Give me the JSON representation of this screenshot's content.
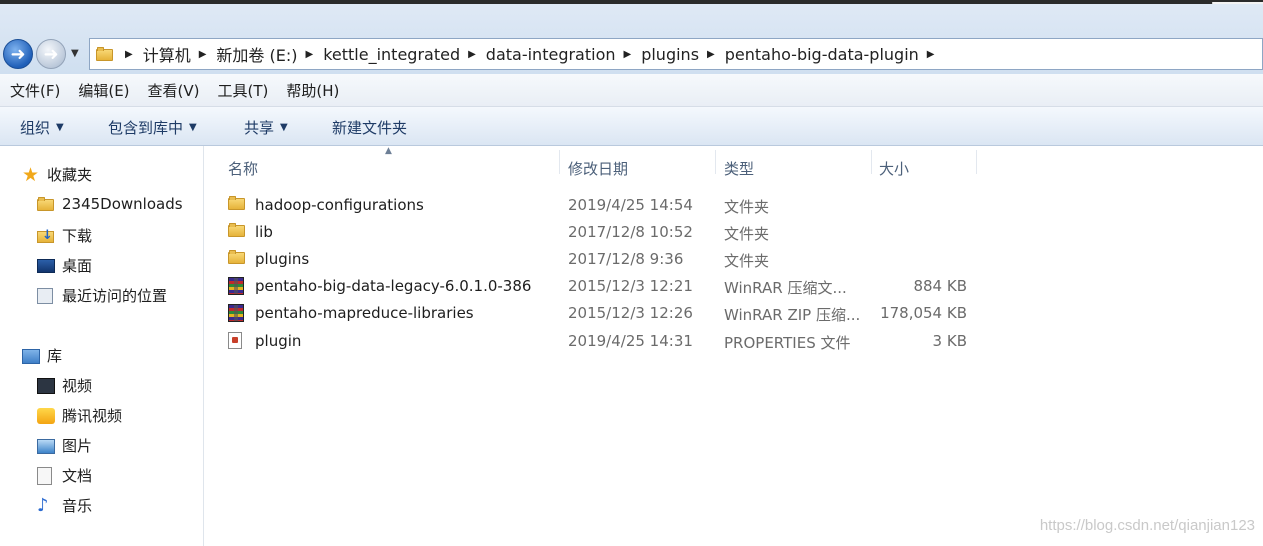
{
  "window": {
    "corner_controls": "⛶ ⌄"
  },
  "address_bar": {
    "breadcrumbs": [
      "计算机",
      "新加卷 (E:)",
      "kettle_integrated",
      "data-integration",
      "plugins",
      "pentaho-big-data-plugin"
    ]
  },
  "menu": {
    "items": [
      "文件(F)",
      "编辑(E)",
      "查看(V)",
      "工具(T)",
      "帮助(H)"
    ]
  },
  "toolbar": {
    "organize": "组织",
    "include_in_library": "包含到库中",
    "share": "共享",
    "new_folder": "新建文件夹"
  },
  "sidebar": {
    "favorites_label": "收藏夹",
    "favorites": [
      "2345Downloads",
      "下载",
      "桌面",
      "最近访问的位置"
    ],
    "libraries_label": "库",
    "libraries": [
      "视频",
      "腾讯视频",
      "图片",
      "文档",
      "音乐"
    ]
  },
  "file_list": {
    "columns": {
      "name": "名称",
      "date": "修改日期",
      "type": "类型",
      "size": "大小"
    },
    "rows": [
      {
        "icon": "folder-icon",
        "name": "hadoop-configurations",
        "date": "2019/4/25 14:54",
        "type": "文件夹",
        "size": ""
      },
      {
        "icon": "folder-icon",
        "name": "lib",
        "date": "2017/12/8 10:52",
        "type": "文件夹",
        "size": ""
      },
      {
        "icon": "folder-icon",
        "name": "plugins",
        "date": "2017/12/8 9:36",
        "type": "文件夹",
        "size": ""
      },
      {
        "icon": "winrar-archive-icon",
        "name": "pentaho-big-data-legacy-6.0.1.0-386",
        "date": "2015/12/3 12:21",
        "type": "WinRAR 压缩文...",
        "size": "884 KB"
      },
      {
        "icon": "winrar-archive-icon",
        "name": "pentaho-mapreduce-libraries",
        "date": "2015/12/3 12:26",
        "type": "WinRAR ZIP 压缩...",
        "size": "178,054 KB"
      },
      {
        "icon": "properties-file-icon",
        "name": "plugin",
        "date": "2019/4/25 14:31",
        "type": "PROPERTIES 文件",
        "size": "3 KB"
      }
    ]
  },
  "watermark": "https://blog.csdn.net/qianjian123"
}
